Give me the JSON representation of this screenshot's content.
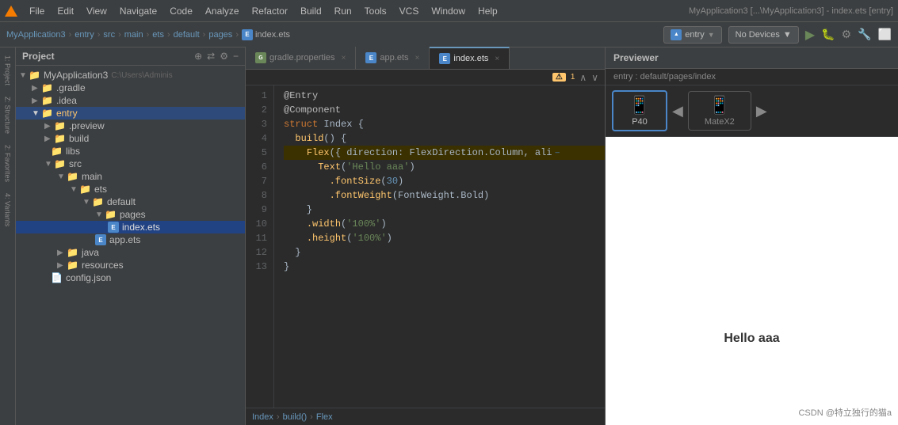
{
  "app": {
    "title": "MyApplication3 [...\\MyApplication3] - index.ets [entry]"
  },
  "menubar": {
    "items": [
      "File",
      "Edit",
      "View",
      "Navigate",
      "Code",
      "Analyze",
      "Refactor",
      "Build",
      "Run",
      "Tools",
      "VCS",
      "Window",
      "Help"
    ],
    "title": "MyApplication3 [...\\MyApplication3] - index.ets [entry]"
  },
  "toolbar": {
    "breadcrumb": [
      "MyApplication3",
      "entry",
      "src",
      "main",
      "ets",
      "default",
      "pages",
      "index.ets"
    ],
    "entry_label": "entry",
    "devices_label": "No Devices",
    "run_icon": "▶",
    "debug_icon": "🐛",
    "gear_icon": "⚙"
  },
  "sidebar": {
    "tabs": [
      "1: Project",
      "Z: Structure",
      "2: Favorites",
      "4: Variants"
    ]
  },
  "project_panel": {
    "title": "Project",
    "root": "MyApplication3",
    "root_path": "C:\\Users\\Adminis",
    "items": [
      {
        "label": ".gradle",
        "type": "folder",
        "indent": 1
      },
      {
        "label": ".idea",
        "type": "folder",
        "indent": 1
      },
      {
        "label": "entry",
        "type": "folder",
        "indent": 1,
        "open": true,
        "highlight": true
      },
      {
        "label": ".preview",
        "type": "folder",
        "indent": 2
      },
      {
        "label": "build",
        "type": "folder",
        "indent": 2
      },
      {
        "label": "libs",
        "type": "folder",
        "indent": 2
      },
      {
        "label": "src",
        "type": "folder",
        "indent": 2,
        "open": true
      },
      {
        "label": "main",
        "type": "folder",
        "indent": 3,
        "open": true
      },
      {
        "label": "ets",
        "type": "folder",
        "indent": 4,
        "open": true
      },
      {
        "label": "default",
        "type": "folder",
        "indent": 5,
        "open": true
      },
      {
        "label": "pages",
        "type": "folder",
        "indent": 6,
        "open": true
      },
      {
        "label": "index.ets",
        "type": "file-ets",
        "indent": 7,
        "selected": true
      },
      {
        "label": "app.ets",
        "type": "file-ets",
        "indent": 6
      },
      {
        "label": "java",
        "type": "folder",
        "indent": 3
      },
      {
        "label": "resources",
        "type": "folder",
        "indent": 3
      },
      {
        "label": "config.json",
        "type": "file",
        "indent": 2
      }
    ]
  },
  "editor": {
    "tabs": [
      {
        "label": "gradle.properties",
        "type": "gradle",
        "active": false
      },
      {
        "label": "app.ets",
        "type": "ets",
        "active": false
      },
      {
        "label": "index.ets",
        "type": "ets",
        "active": true
      }
    ],
    "warning_count": "1",
    "lines": [
      {
        "num": 1,
        "tokens": [
          {
            "t": "@Entry",
            "c": "deco"
          }
        ]
      },
      {
        "num": 2,
        "tokens": [
          {
            "t": "@Component",
            "c": "deco"
          }
        ]
      },
      {
        "num": 3,
        "tokens": [
          {
            "t": "struct ",
            "c": "kw"
          },
          {
            "t": "Index ",
            "c": "plain"
          },
          {
            "t": "{",
            "c": "plain"
          }
        ]
      },
      {
        "num": 4,
        "tokens": [
          {
            "t": "  build",
            "c": "fn"
          },
          {
            "t": "() {",
            "c": "plain"
          }
        ]
      },
      {
        "num": 5,
        "tokens": [
          {
            "t": "    Flex",
            "c": "fn"
          },
          {
            "t": "({ direction: FlexDirection.Column, ali",
            "c": "plain"
          }
        ],
        "warning": true
      },
      {
        "num": 6,
        "tokens": [
          {
            "t": "      Text",
            "c": "fn"
          },
          {
            "t": "(",
            "c": "plain"
          },
          {
            "t": "'Hello aaa'",
            "c": "str"
          },
          {
            "t": ")",
            "c": "plain"
          }
        ]
      },
      {
        "num": 7,
        "tokens": [
          {
            "t": "        .fontSize",
            "c": "fn"
          },
          {
            "t": "(",
            "c": "plain"
          },
          {
            "t": "30",
            "c": "num"
          },
          {
            "t": ")",
            "c": "plain"
          }
        ]
      },
      {
        "num": 8,
        "tokens": [
          {
            "t": "        .fontWeight",
            "c": "fn"
          },
          {
            "t": "(FontWeight.Bold)",
            "c": "plain"
          }
        ]
      },
      {
        "num": 9,
        "tokens": [
          {
            "t": "    }",
            "c": "plain"
          }
        ]
      },
      {
        "num": 10,
        "tokens": [
          {
            "t": "    .width",
            "c": "fn"
          },
          {
            "t": "(",
            "c": "plain"
          },
          {
            "t": "'100%'",
            "c": "str"
          },
          {
            "t": ")",
            "c": "plain"
          }
        ]
      },
      {
        "num": 11,
        "tokens": [
          {
            "t": "    .height",
            "c": "fn"
          },
          {
            "t": "(",
            "c": "plain"
          },
          {
            "t": "'100%'",
            "c": "str"
          },
          {
            "t": ")",
            "c": "plain"
          }
        ]
      },
      {
        "num": 12,
        "tokens": [
          {
            "t": "  }",
            "c": "plain"
          }
        ]
      },
      {
        "num": 13,
        "tokens": [
          {
            "t": "}",
            "c": "plain"
          }
        ]
      }
    ],
    "breadcrumb": [
      "Index",
      "build()",
      "Flex"
    ]
  },
  "previewer": {
    "title": "Previewer",
    "path": "entry : default/pages/index",
    "devices": [
      {
        "label": "P40",
        "active": true
      },
      {
        "label": "MateX2",
        "active": false
      }
    ],
    "preview_text": "Hello aaa",
    "watermark": "CSDN @特立独行的猫a"
  }
}
